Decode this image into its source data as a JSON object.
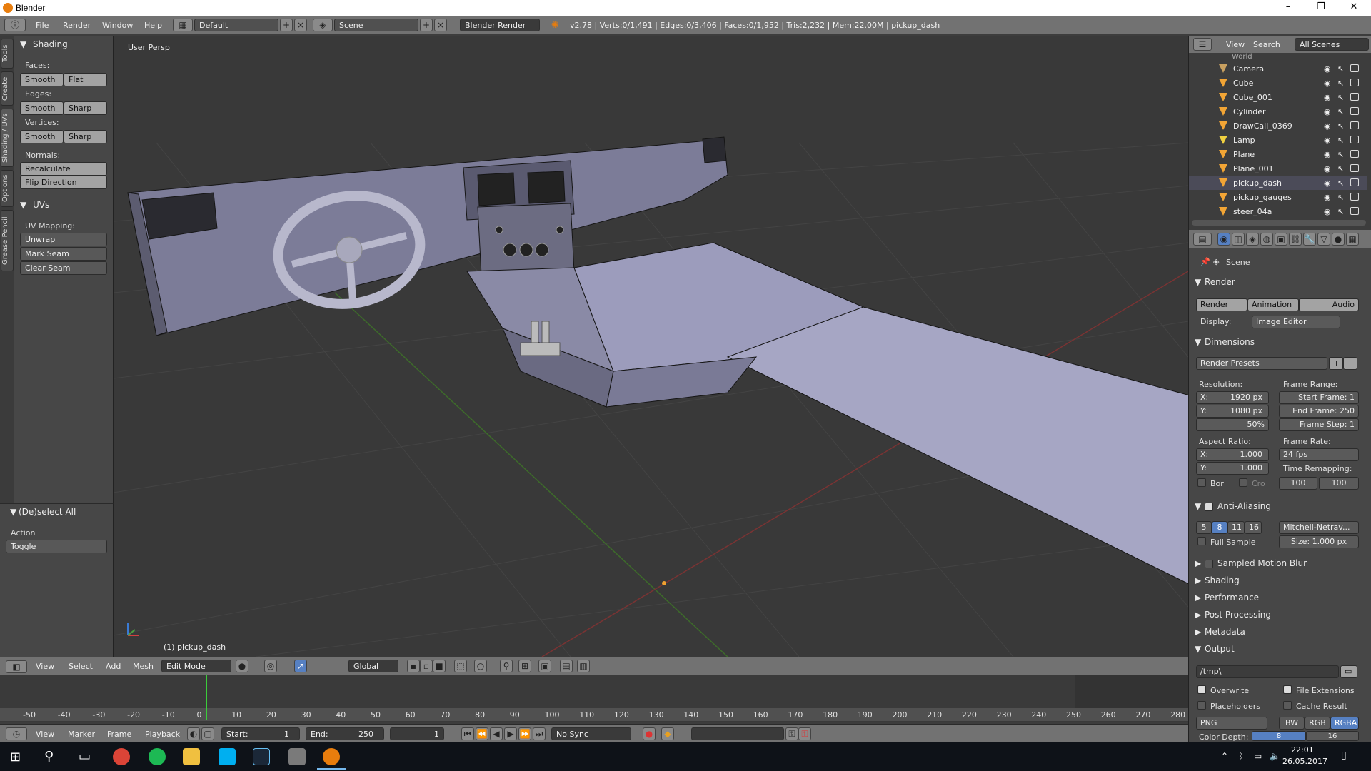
{
  "window": {
    "title": "Blender",
    "minimize": "–",
    "maximize": "❐",
    "close": "✕"
  },
  "info_header": {
    "menus": [
      "File",
      "Render",
      "Window",
      "Help"
    ],
    "layout": "Default",
    "scene": "Scene",
    "engine": "Blender Render",
    "stats": "v2.78 | Verts:0/1,491 | Edges:0/3,406 | Faces:0/1,952 | Tris:2,232 | Mem:22.00M | pickup_dash"
  },
  "vertical_tabs": [
    "Tools",
    "Create",
    "Shading / UVs",
    "Options",
    "Grease Pencil"
  ],
  "tool_shelf": {
    "shading_title": "Shading",
    "faces_label": "Faces:",
    "faces_smooth": "Smooth",
    "faces_flat": "Flat",
    "edges_label": "Edges:",
    "edges_smooth": "Smooth",
    "edges_sharp": "Sharp",
    "vertices_label": "Vertices:",
    "vertices_smooth": "Smooth",
    "vertices_sharp": "Sharp",
    "normals_label": "Normals:",
    "recalculate": "Recalculate",
    "flip_direction": "Flip Direction",
    "uvs_title": "UVs",
    "uv_mapping_label": "UV Mapping:",
    "unwrap": "Unwrap",
    "mark_seam": "Mark Seam",
    "clear_seam": "Clear Seam"
  },
  "last_operator": {
    "title": "(De)select All",
    "action_label": "Action",
    "action_value": "Toggle"
  },
  "viewport": {
    "perspective": "User Persp",
    "object_label": "(1) pickup_dash"
  },
  "view3d_header": {
    "menus": [
      "View",
      "Select",
      "Add",
      "Mesh"
    ],
    "mode": "Edit Mode",
    "orientation": "Global"
  },
  "timeline": {
    "ticks": [
      "-50",
      "-40",
      "-30",
      "-20",
      "-10",
      "0",
      "10",
      "20",
      "30",
      "40",
      "50",
      "60",
      "70",
      "80",
      "90",
      "100",
      "110",
      "120",
      "130",
      "140",
      "150",
      "160",
      "170",
      "180",
      "190",
      "200",
      "210",
      "220",
      "230",
      "240",
      "250",
      "260",
      "270",
      "280"
    ],
    "current_frame": 1,
    "menus": [
      "View",
      "Marker",
      "Frame",
      "Playback"
    ],
    "start_label": "Start:",
    "start_value": "1",
    "end_label": "End:",
    "end_value": "250",
    "frame_value": "1",
    "sync": "No Sync"
  },
  "outliner": {
    "menus": [
      "View",
      "Search"
    ],
    "filter": "All Scenes",
    "partial_row": "World",
    "items": [
      {
        "name": "Camera",
        "type": "camera-icon"
      },
      {
        "name": "Cube",
        "type": "mesh-icon"
      },
      {
        "name": "Cube_001",
        "type": "mesh-icon"
      },
      {
        "name": "Cylinder",
        "type": "mesh-icon"
      },
      {
        "name": "DrawCall_0369",
        "type": "mesh-icon"
      },
      {
        "name": "Lamp",
        "type": "lamp-icon"
      },
      {
        "name": "Plane",
        "type": "mesh-icon"
      },
      {
        "name": "Plane_001",
        "type": "mesh-icon"
      },
      {
        "name": "pickup_dash",
        "type": "mesh-icon"
      },
      {
        "name": "pickup_gauges",
        "type": "mesh-icon"
      },
      {
        "name": "steer_04a",
        "type": "mesh-icon"
      }
    ]
  },
  "properties": {
    "context": "Scene",
    "render_title": "Render",
    "render_btn": "Render",
    "animation_btn": "Animation",
    "audio_btn": "Audio",
    "display_label": "Display:",
    "display_value": "Image Editor",
    "dimensions_title": "Dimensions",
    "render_presets": "Render Presets",
    "resolution_label": "Resolution:",
    "res_x": "X:",
    "res_x_val": "1920 px",
    "res_y": "Y:",
    "res_y_val": "1080 px",
    "res_pct": "50%",
    "frame_range_label": "Frame Range:",
    "start_frame": "Start Frame: 1",
    "end_frame": "End Frame: 250",
    "frame_step": "Frame Step: 1",
    "aspect_label": "Aspect Ratio:",
    "aspect_x": "X:",
    "aspect_x_val": "1.000",
    "aspect_y": "Y:",
    "aspect_y_val": "1.000",
    "frame_rate_label": "Frame Rate:",
    "frame_rate": "24 fps",
    "time_remap_label": "Time Remapping:",
    "remap_old": "100",
    "remap_new": "100",
    "bor": "Bor",
    "cro": "Cro",
    "aa_title": "Anti-Aliasing",
    "aa_samples": [
      "5",
      "8",
      "11",
      "16"
    ],
    "aa_filter": "Mitchell-Netrav...",
    "full_sample": "Full Sample",
    "aa_size": "Size: 1.000 px",
    "motion_blur": "Sampled Motion Blur",
    "shading": "Shading",
    "performance": "Performance",
    "post_processing": "Post Processing",
    "metadata": "Metadata",
    "output_title": "Output",
    "output_path": "/tmp\\",
    "overwrite": "Overwrite",
    "file_extensions": "File Extensions",
    "placeholders": "Placeholders",
    "cache_result": "Cache Result",
    "format": "PNG",
    "bw": "BW",
    "rgb": "RGB",
    "rgba": "RGBA",
    "color_depth": "Color Depth:",
    "depth_8": "8",
    "depth_16": "16"
  },
  "taskbar": {
    "time": "22:01",
    "date": "26.05.2017"
  },
  "colors": {
    "accent_blue": "#5680c2",
    "blender_orange": "#e87d0d",
    "header_gray": "#727272",
    "viewport_bg": "#393939"
  }
}
